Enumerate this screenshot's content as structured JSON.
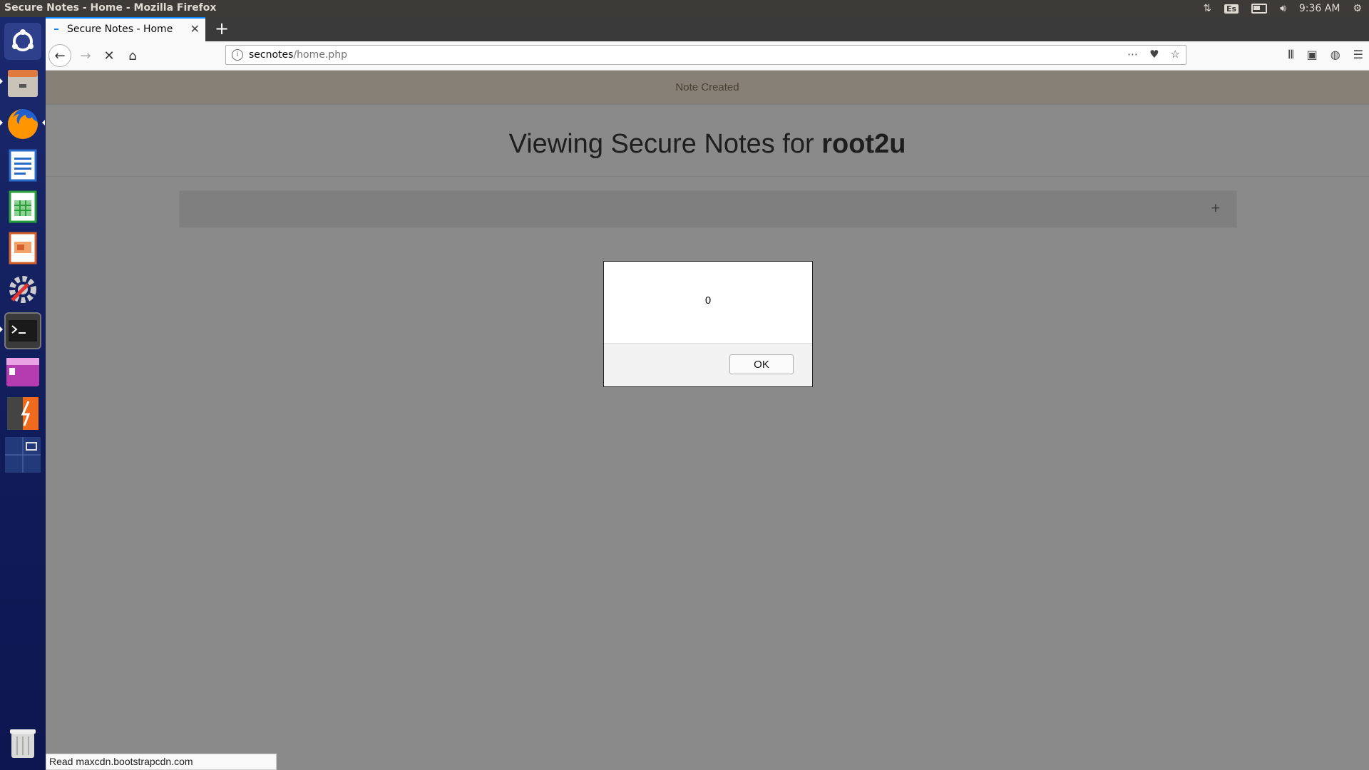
{
  "os_panel": {
    "window_title": "Secure Notes - Home - Mozilla Firefox",
    "keyboard_layout": "Es",
    "clock": "9:36 AM",
    "icons": [
      "network-icon",
      "keyboard-layout-icon",
      "battery-icon",
      "volume-icon",
      "settings-gear-icon"
    ]
  },
  "launcher": {
    "items": [
      {
        "name": "ubuntu-dash-icon"
      },
      {
        "name": "files-icon"
      },
      {
        "name": "firefox-icon"
      },
      {
        "name": "libreoffice-writer-icon"
      },
      {
        "name": "libreoffice-calc-icon"
      },
      {
        "name": "libreoffice-impress-icon"
      },
      {
        "name": "system-settings-icon"
      },
      {
        "name": "terminal-icon"
      },
      {
        "name": "app-launcher-icon"
      },
      {
        "name": "burpsuite-icon"
      },
      {
        "name": "workspace-switcher-icon"
      },
      {
        "name": "trash-icon"
      }
    ]
  },
  "browser": {
    "tab_title": "Secure Notes - Home",
    "new_tab_label": "+",
    "url_domain": "secnotes",
    "url_path": "/home.php",
    "status_text": "Read maxcdn.bootstrapcdn.com"
  },
  "page": {
    "alert_text": "Note Created",
    "heading_prefix": "Viewing Secure Notes for ",
    "username": "root2u",
    "add_note_label": "+"
  },
  "dialog": {
    "message": "0",
    "ok_label": "OK"
  }
}
